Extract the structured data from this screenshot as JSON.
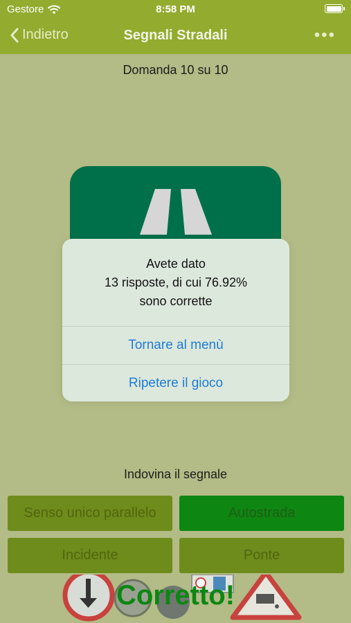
{
  "status_bar": {
    "carrier": "Gestore",
    "time": "8:58 PM",
    "battery_level": 1.0
  },
  "nav_bar": {
    "back_label": "Indietro",
    "title": "Segnali Stradali",
    "more_label": "•••"
  },
  "question_counter": "Domanda 10 su 10",
  "dialog": {
    "message_line1": "Avete dato",
    "message_line2": "13 risposte, di cui 76.92%",
    "message_line3": "sono corrette",
    "button_menu": "Tornare al menù",
    "button_replay": "Ripetere il gioco"
  },
  "prompt": "Indovina il segnale",
  "answers": [
    {
      "label": "Senso unico parallelo",
      "state": "dim"
    },
    {
      "label": "Autostrada",
      "state": "correct"
    },
    {
      "label": "Incidente",
      "state": "dim"
    },
    {
      "label": "Ponte",
      "state": "dim"
    }
  ],
  "feedback": "Corretto!",
  "colors": {
    "nav_green": "#93ab2e",
    "background": "#b3bb86",
    "motorway_green": "#00704a",
    "correct_green": "#0d8612",
    "link_blue": "#1f7bd6"
  }
}
